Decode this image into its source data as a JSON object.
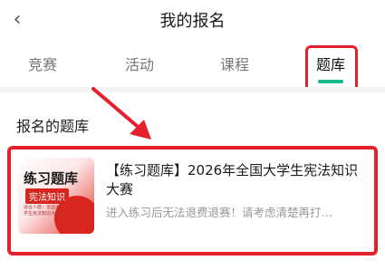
{
  "header": {
    "back_icon": "‹",
    "title": "我的报名"
  },
  "tabs": [
    {
      "label": "竞赛",
      "active": false
    },
    {
      "label": "活动",
      "active": false
    },
    {
      "label": "课程",
      "active": false
    },
    {
      "label": "题库",
      "active": true
    }
  ],
  "section": {
    "title": "报名的题库"
  },
  "item": {
    "title": "【练习题库】2026年全国大学生宪法知识大赛",
    "description": "进入练习后无法退费退赛！请考虑清楚再打…",
    "thumbnail": {
      "title": "练习题库",
      "subtitle": "宪法知识",
      "fine_print": "适合人群：全国大学生宪法知识大赛"
    }
  },
  "colors": {
    "accent": "#17b88a",
    "highlight": "#e5202a"
  }
}
